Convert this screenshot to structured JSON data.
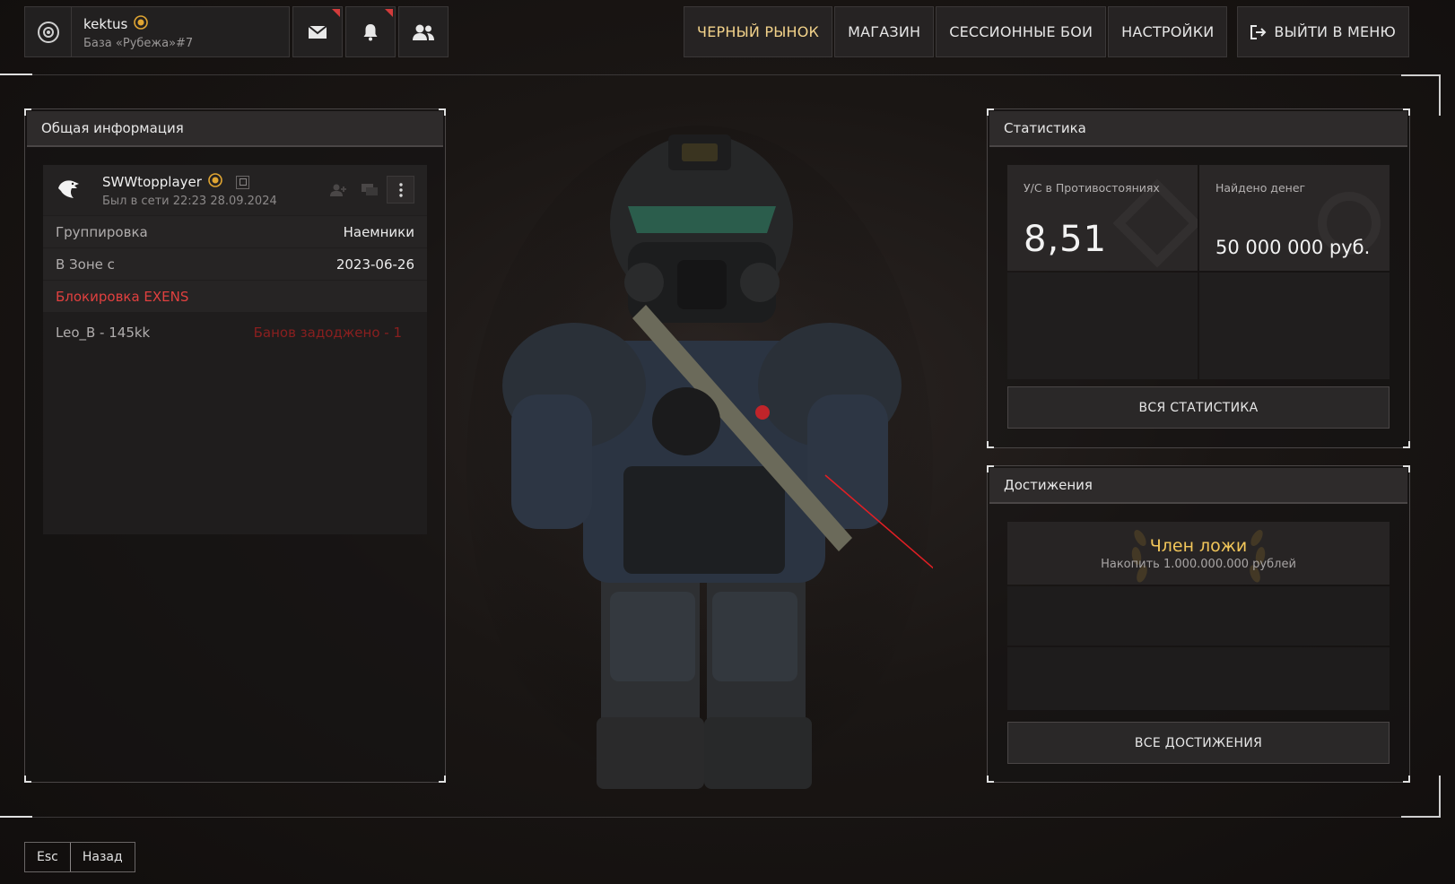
{
  "header": {
    "username": "kektus",
    "subtitle": "База «Рубежа»#7"
  },
  "nav": {
    "items": [
      "ЧЕРНЫЙ РЫНОК",
      "МАГАЗИН",
      "СЕССИОННЫЕ БОИ",
      "НАСТРОЙКИ"
    ],
    "exit_label": "ВЫЙТИ В МЕНЮ"
  },
  "general": {
    "title": "Общая информация",
    "player_name": "SWWtopplayer",
    "last_seen": "Был в сети 22:23 28.09.2024",
    "rows": [
      {
        "key": "Группировка",
        "value": "Наемники"
      },
      {
        "key": "В Зоне с",
        "value": "2023-06-26"
      },
      {
        "key": "Блокировка EXENS",
        "value": ""
      }
    ],
    "note_key": "Leo_B - 145kk",
    "note_value": "Банов задоджено - 1"
  },
  "stats": {
    "title": "Статистика",
    "kd_label": "У/С в Противостояниях",
    "kd_value": "8,51",
    "money_label": "Найдено денег",
    "money_value": "50 000 000 руб.",
    "all_button": "ВСЯ СТАТИСТИКА"
  },
  "achievements": {
    "title": "Достижения",
    "item_title": "Член ложи",
    "item_desc": "Накопить 1.000.000.000 рублей",
    "all_button": "ВСЕ ДОСТИЖЕНИЯ"
  },
  "footer": {
    "esc": "Esc",
    "back": "Назад"
  },
  "colors": {
    "accent_gold": "#f2c65a",
    "alert_red": "#e0403f",
    "market_gold": "#f2d28a"
  }
}
